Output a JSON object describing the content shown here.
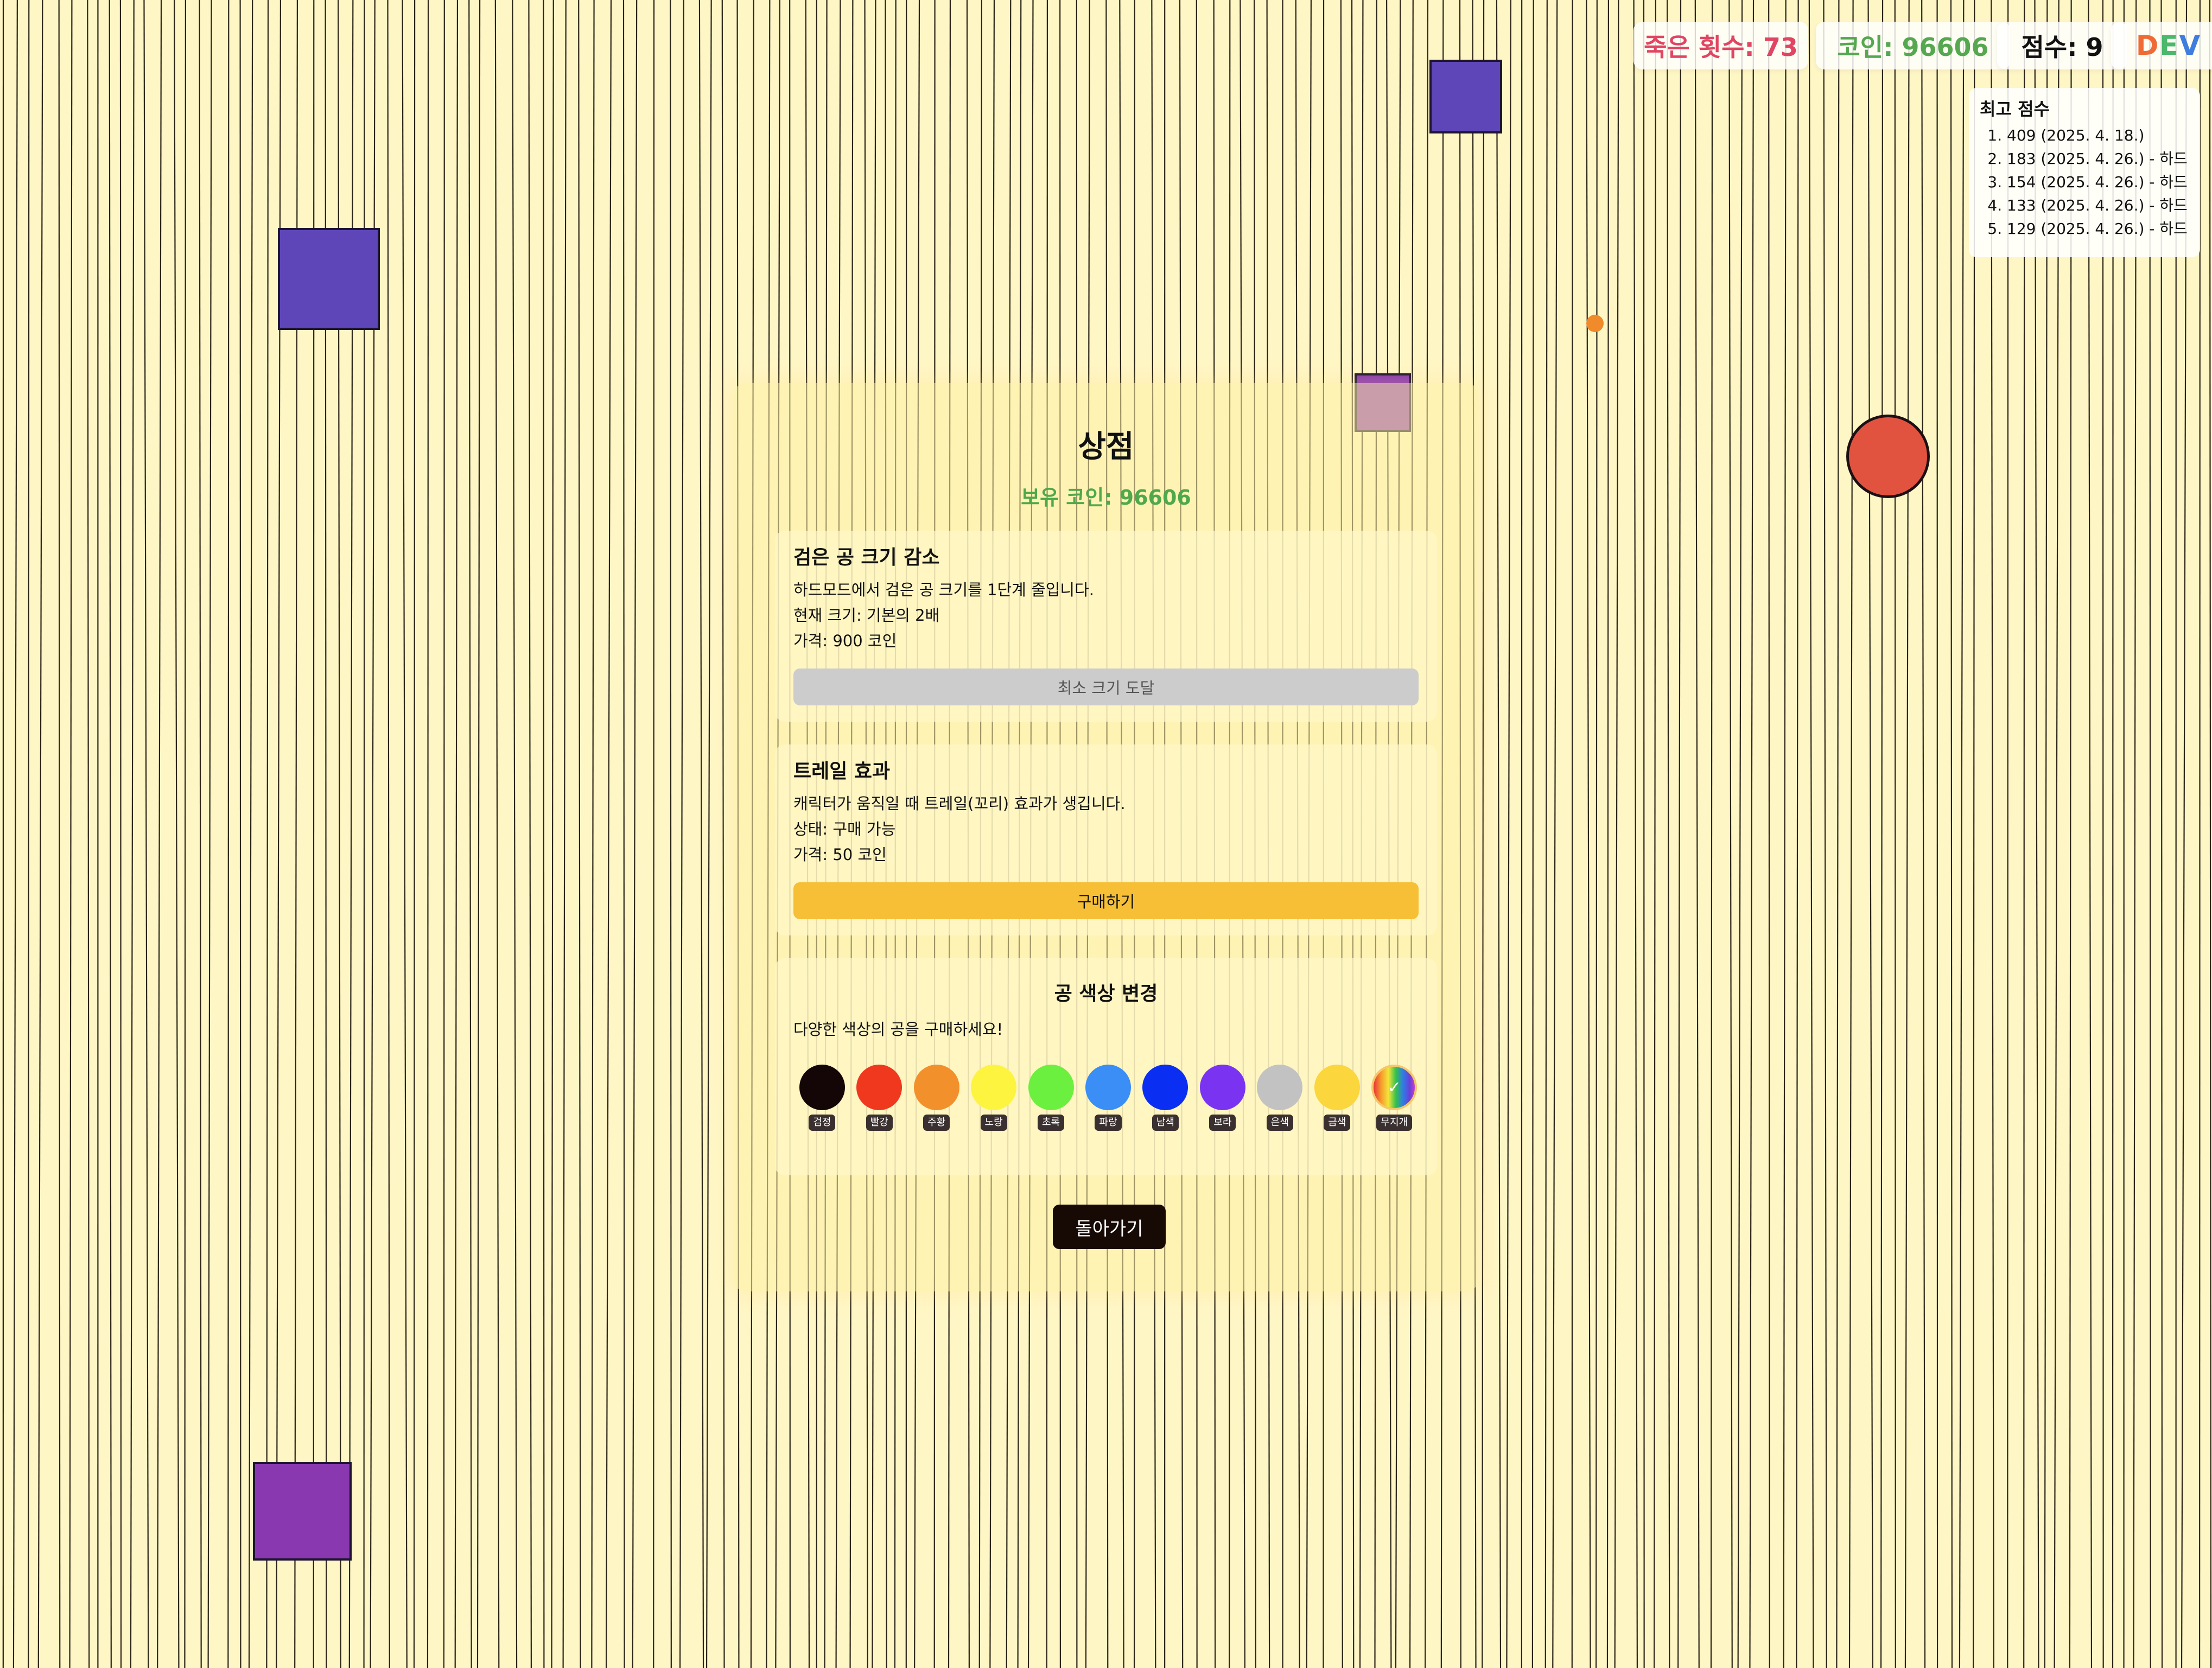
{
  "hud": {
    "deaths_label": "죽은 횟수: 73",
    "coins_label": "코인: 96606",
    "score_label": "점수: 9",
    "dev_letters": [
      "D",
      "E",
      "V"
    ]
  },
  "high_scores": {
    "title": "최고 점수",
    "entries": [
      "409 (2025. 4. 18.)",
      "183 (2025. 4. 26.) - 하드",
      "154 (2025. 4. 26.) - 하드",
      "133 (2025. 4. 26.) - 하드",
      "129 (2025. 4. 26.) - 하드"
    ]
  },
  "shop": {
    "title": "상점",
    "balance": "보유 코인: 96606",
    "ball_size": {
      "title": "검은 공 크기 감소",
      "description": "하드모드에서 검은 공 크기를 1단계 줄입니다.",
      "current": "현재 크기: 기본의 2배",
      "price": "가격: 900 코인",
      "button": "최소 크기 도달"
    },
    "trail": {
      "title": "트레일 효과",
      "description": "캐릭터가 움직일 때 트레일(꼬리) 효과가 생깁니다.",
      "status": "상태: 구매 가능",
      "price": "가격: 50 코인",
      "button": "구매하기"
    },
    "ball_color": {
      "title": "공 색상 변경",
      "intro": "다양한 색상의 공을 구매하세요!",
      "colors": [
        {
          "name": "검정",
          "hex": "#140606"
        },
        {
          "name": "빨강",
          "hex": "#f0381f"
        },
        {
          "name": "주황",
          "hex": "#f2902c"
        },
        {
          "name": "노랑",
          "hex": "#fdf43f"
        },
        {
          "name": "초록",
          "hex": "#6bf03f"
        },
        {
          "name": "파랑",
          "hex": "#3a8ef5"
        },
        {
          "name": "남색",
          "hex": "#0a2ff2"
        },
        {
          "name": "보라",
          "hex": "#7a33f0"
        },
        {
          "name": "은색",
          "hex": "#c2c2c2"
        },
        {
          "name": "금색",
          "hex": "#fbd63c"
        },
        {
          "name": "무지개",
          "hex": "rainbow",
          "selected": true,
          "check": "✓"
        }
      ]
    },
    "back_button": "돌아가기"
  },
  "colors": {
    "background": "#fff6c6",
    "obstacle_blue": "#5f46b8",
    "obstacle_purple": "#8a38b0",
    "enemy_ball": "#e2533f",
    "coin": "#f08a2a"
  }
}
